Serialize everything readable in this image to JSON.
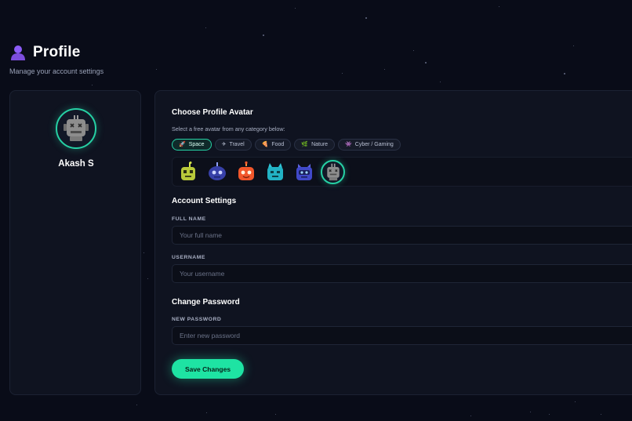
{
  "header": {
    "title": "Profile",
    "subtitle": "Manage your account settings",
    "icon": "user-silhouette-icon"
  },
  "profile_card": {
    "avatar": "gray-robot-avatar",
    "name": "Akash S"
  },
  "avatar_section": {
    "title": "Choose Profile Avatar",
    "hint": "Select a free avatar from any category below:",
    "categories": [
      {
        "label": "Space",
        "icon": "rocket-icon",
        "active": true
      },
      {
        "label": "Travel",
        "icon": "airplane-icon",
        "active": false
      },
      {
        "label": "Food",
        "icon": "pizza-icon",
        "active": false
      },
      {
        "label": "Nature",
        "icon": "leaf-icon",
        "active": false
      },
      {
        "label": "Cyber / Gaming",
        "icon": "gamepad-icon",
        "active": false
      }
    ],
    "avatars": [
      "lime-robot",
      "navy-robot",
      "orange-robot",
      "teal-robot",
      "blue-robot",
      "gray-robot"
    ],
    "selected_avatar": "gray-robot"
  },
  "account_settings": {
    "title": "Account Settings",
    "full_name_label": "FULL NAME",
    "full_name_placeholder": "Your full name",
    "username_label": "USERNAME",
    "username_placeholder": "Your username"
  },
  "password_section": {
    "title": "Change Password",
    "new_password_label": "NEW PASSWORD",
    "new_password_placeholder": "Enter new password"
  },
  "actions": {
    "save_label": "Save Changes"
  },
  "colors": {
    "background": "#090c18",
    "card": "#0f1320",
    "accent": "#1ee3a3"
  }
}
